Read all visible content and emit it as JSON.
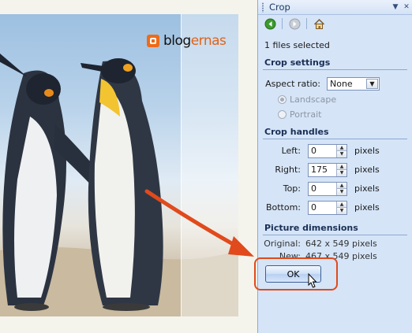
{
  "brand": {
    "part1": "blog",
    "part2": "ernas"
  },
  "pane": {
    "title": "Crop",
    "title_controls": [
      "▼",
      "✕"
    ],
    "files_selected": "1 files selected",
    "crop_settings": {
      "header": "Crop settings",
      "aspect_label": "Aspect ratio:",
      "aspect_value": "None",
      "landscape": "Landscape",
      "portrait": "Portrait"
    },
    "crop_handles": {
      "header": "Crop handles",
      "rows": [
        {
          "label": "Left:",
          "value": "0",
          "unit": "pixels"
        },
        {
          "label": "Right:",
          "value": "175",
          "unit": "pixels"
        },
        {
          "label": "Top:",
          "value": "0",
          "unit": "pixels"
        },
        {
          "label": "Bottom:",
          "value": "0",
          "unit": "pixels"
        }
      ]
    },
    "dimensions": {
      "header": "Picture dimensions",
      "original_label": "Original:",
      "original_value": "642 x 549 pixels",
      "new_label": "New:",
      "new_value": "467 x 549 pixels"
    },
    "ok_label": "OK"
  },
  "icons": {
    "back": "back-arrow-icon",
    "forward": "forward-arrow-icon",
    "home": "home-icon"
  },
  "colors": {
    "pane_bg": "#d5e4f7",
    "highlight": "#e04a1c",
    "brand_orange": "#ee6b18"
  }
}
